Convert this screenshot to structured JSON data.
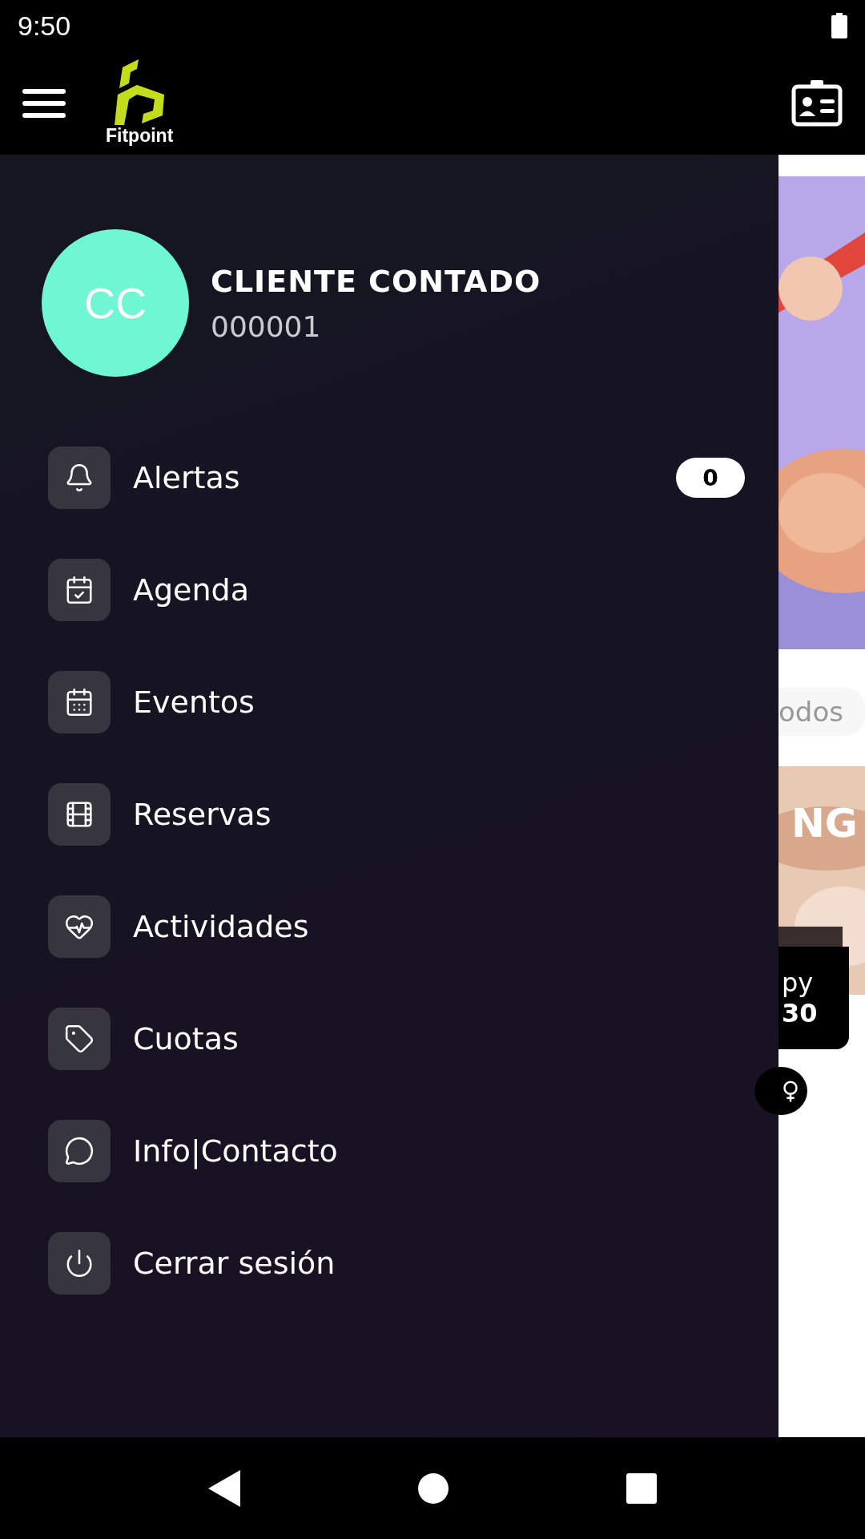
{
  "status_bar": {
    "time": "9:50"
  },
  "app_bar": {
    "logo_text": "Fitpoint"
  },
  "drawer": {
    "profile": {
      "initials": "CC",
      "name": "CLIENTE CONTADO",
      "id": "000001"
    },
    "items": [
      {
        "kind": "bell",
        "label": "Alertas",
        "badge": "0"
      },
      {
        "kind": "agenda",
        "label": "Agenda"
      },
      {
        "kind": "events",
        "label": "Eventos"
      },
      {
        "kind": "bookings",
        "label": "Reservas"
      },
      {
        "kind": "activities",
        "label": "Actividades"
      },
      {
        "kind": "fees",
        "label": "Cuotas"
      },
      {
        "kind": "info",
        "label": "Info|Contacto"
      },
      {
        "kind": "logout",
        "label": "Cerrar sesión"
      }
    ]
  },
  "background_page": {
    "chip": "odos",
    "card_title": "NG",
    "card_line_1": "py",
    "card_line_2": "30"
  }
}
